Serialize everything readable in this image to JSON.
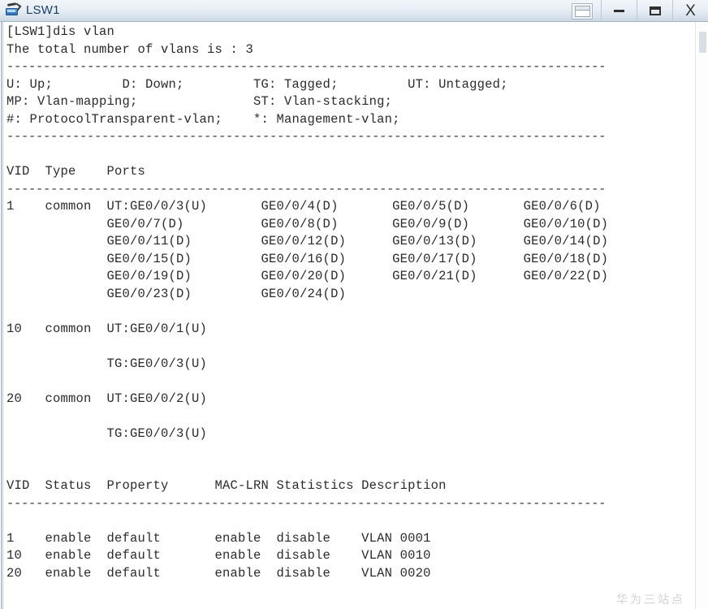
{
  "window": {
    "title": "LSW1",
    "icon": "switch-icon",
    "controls": {
      "restore_label": "",
      "minimize_label": "",
      "maximize_label": "",
      "close_label": "X"
    }
  },
  "terminal": {
    "separator": "----------------------------------------------------------------------------------",
    "lines": [
      {
        "type": "text",
        "text": "[LSW1]dis vlan"
      },
      {
        "type": "text",
        "text": "The total number of vlans is : 3"
      },
      {
        "type": "sep"
      },
      {
        "type": "text",
        "text": "U: Up;         D: Down;         TG: Tagged;         UT: Untagged;"
      },
      {
        "type": "text",
        "text": "MP: Vlan-mapping;               ST: Vlan-stacking;"
      },
      {
        "type": "text",
        "text": "#: ProtocolTransparent-vlan;    *: Management-vlan;"
      },
      {
        "type": "sep"
      },
      {
        "type": "text",
        "text": ""
      },
      {
        "type": "text",
        "text": "VID  Type    Ports"
      },
      {
        "type": "sep"
      },
      {
        "type": "text",
        "text": "1    common  UT:GE0/0/3(U)       GE0/0/4(D)       GE0/0/5(D)       GE0/0/6(D)"
      },
      {
        "type": "text",
        "text": "             GE0/0/7(D)          GE0/0/8(D)       GE0/0/9(D)       GE0/0/10(D)"
      },
      {
        "type": "text",
        "text": "             GE0/0/11(D)         GE0/0/12(D)      GE0/0/13(D)      GE0/0/14(D)"
      },
      {
        "type": "text",
        "text": "             GE0/0/15(D)         GE0/0/16(D)      GE0/0/17(D)      GE0/0/18(D)"
      },
      {
        "type": "text",
        "text": "             GE0/0/19(D)         GE0/0/20(D)      GE0/0/21(D)      GE0/0/22(D)"
      },
      {
        "type": "text",
        "text": "             GE0/0/23(D)         GE0/0/24(D)"
      },
      {
        "type": "text",
        "text": ""
      },
      {
        "type": "text",
        "text": "10   common  UT:GE0/0/1(U)"
      },
      {
        "type": "text",
        "text": ""
      },
      {
        "type": "text",
        "text": "             TG:GE0/0/3(U)"
      },
      {
        "type": "text",
        "text": ""
      },
      {
        "type": "text",
        "text": "20   common  UT:GE0/0/2(U)"
      },
      {
        "type": "text",
        "text": ""
      },
      {
        "type": "text",
        "text": "             TG:GE0/0/3(U)"
      },
      {
        "type": "text",
        "text": ""
      },
      {
        "type": "text",
        "text": ""
      },
      {
        "type": "text",
        "text": "VID  Status  Property      MAC-LRN Statistics Description"
      },
      {
        "type": "sep"
      },
      {
        "type": "text",
        "text": ""
      },
      {
        "type": "text",
        "text": "1    enable  default       enable  disable    VLAN 0001"
      },
      {
        "type": "text",
        "text": "10   enable  default       enable  disable    VLAN 0010"
      },
      {
        "type": "text",
        "text": "20   enable  default       enable  disable    VLAN 0020"
      }
    ]
  },
  "watermark": {
    "text": "华为三站点"
  },
  "colors": {
    "titlebar_top": "#f2f6fa",
    "titlebar_bottom": "#ccd8e4",
    "title_text": "#1a3e66",
    "terminal_bg": "#ffffff",
    "terminal_text": "#2b2b2b",
    "accent": "#2f72b5"
  }
}
